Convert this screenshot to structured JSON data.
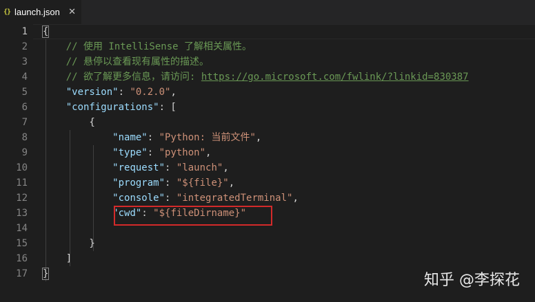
{
  "tab": {
    "icon": "json-braces-icon",
    "icon_glyph": "{}",
    "label": "launch.json",
    "close_glyph": "✕"
  },
  "colors": {
    "background": "#1e1e1e",
    "comment": "#6a9955",
    "key": "#9cdcfe",
    "string": "#ce9178",
    "highlight_box": "#d42a2a"
  },
  "active_line": 1,
  "line_numbers": [
    "1",
    "2",
    "3",
    "4",
    "5",
    "6",
    "7",
    "8",
    "9",
    "10",
    "11",
    "12",
    "13",
    "14",
    "15",
    "16",
    "17"
  ],
  "lines": [
    [
      {
        "t": "{",
        "c": "punc bm"
      }
    ],
    [
      {
        "t": "    "
      },
      {
        "t": "// 使用 IntelliSense 了解相关属性。",
        "c": "cm"
      }
    ],
    [
      {
        "t": "    "
      },
      {
        "t": "// 悬停以查看现有属性的描述。",
        "c": "cm"
      }
    ],
    [
      {
        "t": "    "
      },
      {
        "t": "// 欲了解更多信息，请访问: ",
        "c": "cm"
      },
      {
        "t": "https://go.microsoft.com/fwlink/?linkid=830387",
        "c": "url"
      }
    ],
    [
      {
        "t": "    "
      },
      {
        "t": "\"version\"",
        "c": "key"
      },
      {
        "t": ": "
      },
      {
        "t": "\"0.2.0\"",
        "c": "str"
      },
      {
        "t": ","
      }
    ],
    [
      {
        "t": "    "
      },
      {
        "t": "\"configurations\"",
        "c": "key"
      },
      {
        "t": ": ["
      }
    ],
    [
      {
        "t": "        {"
      }
    ],
    [
      {
        "t": "            "
      },
      {
        "t": "\"name\"",
        "c": "key"
      },
      {
        "t": ": "
      },
      {
        "t": "\"Python: 当前文件\"",
        "c": "str"
      },
      {
        "t": ","
      }
    ],
    [
      {
        "t": "            "
      },
      {
        "t": "\"type\"",
        "c": "key"
      },
      {
        "t": ": "
      },
      {
        "t": "\"python\"",
        "c": "str"
      },
      {
        "t": ","
      }
    ],
    [
      {
        "t": "            "
      },
      {
        "t": "\"request\"",
        "c": "key"
      },
      {
        "t": ": "
      },
      {
        "t": "\"launch\"",
        "c": "str"
      },
      {
        "t": ","
      }
    ],
    [
      {
        "t": "            "
      },
      {
        "t": "\"program\"",
        "c": "key"
      },
      {
        "t": ": "
      },
      {
        "t": "\"${file}\"",
        "c": "str"
      },
      {
        "t": ","
      }
    ],
    [
      {
        "t": "            "
      },
      {
        "t": "\"console\"",
        "c": "key"
      },
      {
        "t": ": "
      },
      {
        "t": "\"integratedTerminal\"",
        "c": "str"
      },
      {
        "t": ","
      }
    ],
    [
      {
        "t": "            "
      },
      {
        "t": "\"cwd\"",
        "c": "key"
      },
      {
        "t": ": "
      },
      {
        "t": "\"${fileDirname}\"",
        "c": "str"
      }
    ],
    [
      {
        "t": ""
      }
    ],
    [
      {
        "t": "        }"
      }
    ],
    [
      {
        "t": "    ]"
      }
    ],
    [
      {
        "t": "}",
        "c": "punc bm"
      }
    ]
  ],
  "watermark": "知乎 @李探花"
}
